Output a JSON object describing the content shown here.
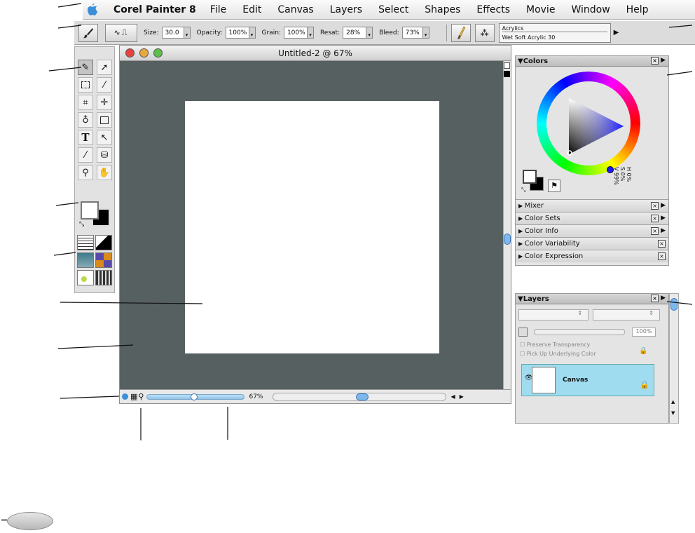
{
  "menubar": {
    "app_name": "Corel Painter 8",
    "items": [
      "File",
      "Edit",
      "Canvas",
      "Layers",
      "Select",
      "Shapes",
      "Effects",
      "Movie",
      "Window",
      "Help"
    ]
  },
  "property_bar": {
    "size_label": "Size:",
    "size_value": "30.0",
    "opacity_label": "Opacity:",
    "opacity_value": "100%",
    "grain_label": "Grain:",
    "grain_value": "100%",
    "resat_label": "Resat:",
    "resat_value": "28%",
    "bleed_label": "Bleed:",
    "bleed_value": "73%"
  },
  "brush_selector": {
    "category": "Acrylics",
    "variant": "Wet Soft Acrylic 30"
  },
  "document": {
    "title": "Untitled-2 @ 67%",
    "zoom": "67%"
  },
  "colors_palette": {
    "title": "Colors",
    "hsv": [
      "H 0%",
      "S 0%",
      "V 99%"
    ],
    "collapsed": [
      "Mixer",
      "Color Sets",
      "Color Info",
      "Color Variability",
      "Color Expression"
    ]
  },
  "layers_palette": {
    "title": "Layers",
    "opacity": "100%",
    "preserve_transparency": "Preserve Transparency",
    "pick_up_underlying": "Pick Up Underlying Color",
    "layer_name": "Canvas"
  },
  "colors": {
    "canvas_background": "#566060",
    "selection": "#9fdcef",
    "accent": "#3a78c0"
  }
}
